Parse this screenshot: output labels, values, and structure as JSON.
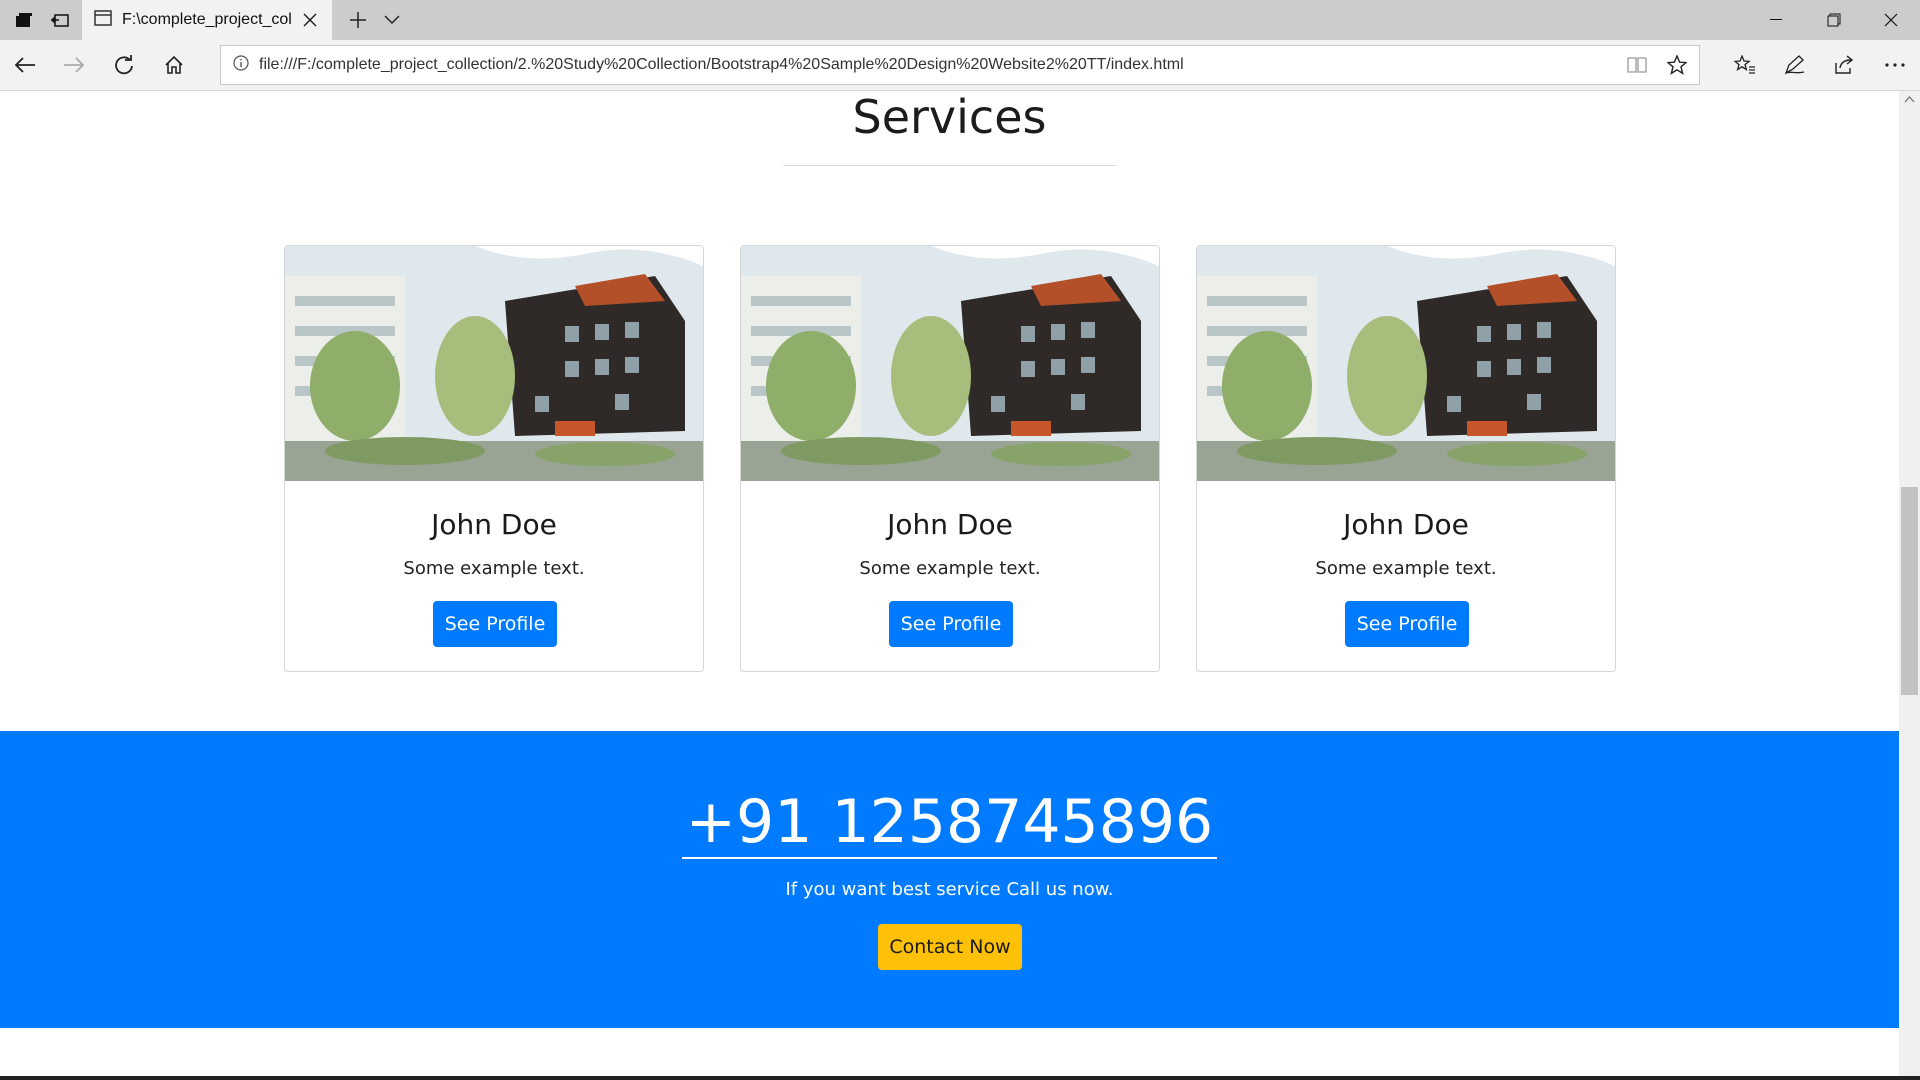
{
  "browser": {
    "tab_title": "F:\\complete_project_col",
    "url": "file:///F:/complete_project_collection/2.%20Study%20Collection/Bootstrap4%20Sample%20Design%20Website2%20TT/index.html"
  },
  "services": {
    "title": "Services",
    "cards": [
      {
        "name": "John Doe",
        "text": "Some example text.",
        "button": "See Profile",
        "image": "apartment-building-photo"
      },
      {
        "name": "John Doe",
        "text": "Some example text.",
        "button": "See Profile",
        "image": "apartment-building-photo"
      },
      {
        "name": "John Doe",
        "text": "Some example text.",
        "button": "See Profile",
        "image": "apartment-building-photo"
      }
    ]
  },
  "cta": {
    "phone": "+91 1258745896",
    "text": "If you want best service Call us now.",
    "button": "Contact Now"
  },
  "colors": {
    "primary": "#007bff",
    "warning": "#ffc107",
    "chrome": "#cccccc"
  }
}
